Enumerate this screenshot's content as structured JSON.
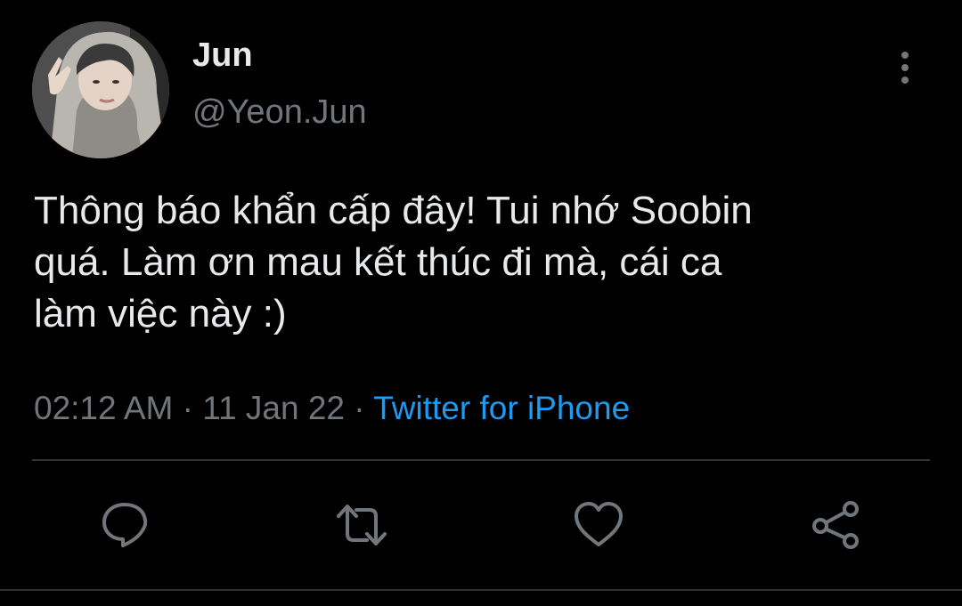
{
  "author": {
    "display_name": "Jun",
    "handle": "@Yeon.Jun",
    "avatar": "avatar-photo"
  },
  "tweet": {
    "text": "Thông báo khẩn cấp đây! Tui nhớ Soobin\nquá. Làm ơn mau kết thúc đi mà, cái ca\nlàm việc này :)",
    "time": "02:12 AM",
    "separator": "·",
    "date": "11 Jan 22",
    "source": "Twitter for iPhone"
  },
  "icons": {
    "more": "more-vertical-icon",
    "reply": "reply-icon",
    "retweet": "retweet-icon",
    "like": "heart-icon",
    "share": "share-icon"
  },
  "colors": {
    "background": "#000000",
    "text": "#e7e9ea",
    "secondary": "#71767b",
    "link": "#1d9bf0",
    "divider": "#2f3336"
  }
}
